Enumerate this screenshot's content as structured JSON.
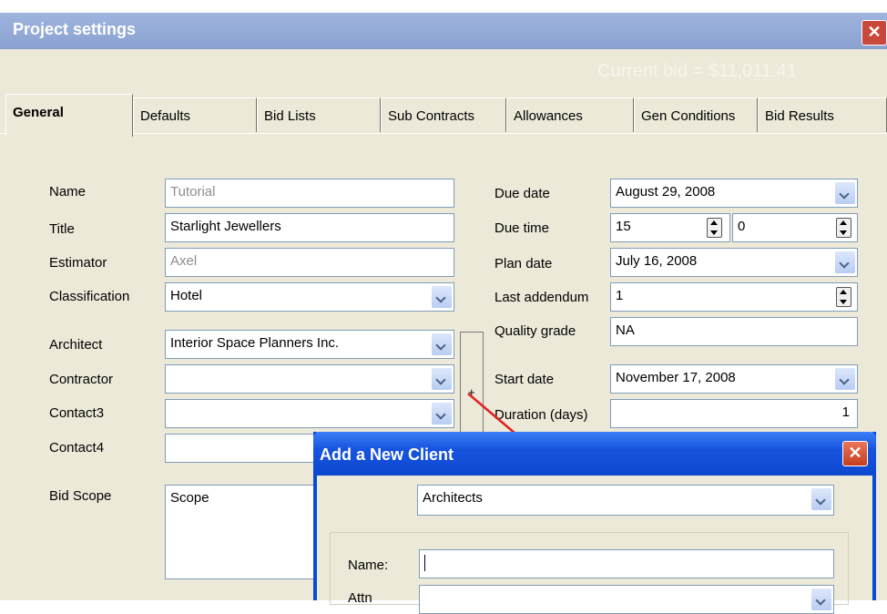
{
  "window": {
    "title": "Project settings",
    "close_label": "✕",
    "current_bid": "Current bid = $11,011.41"
  },
  "tabs": [
    {
      "label": "General",
      "active": true
    },
    {
      "label": "Defaults"
    },
    {
      "label": "Bid Lists"
    },
    {
      "label": "Sub Contracts"
    },
    {
      "label": "Allowances"
    },
    {
      "label": "Gen Conditions"
    },
    {
      "label": "Bid Results"
    }
  ],
  "left": {
    "name_label": "Name",
    "name_value": "Tutorial",
    "title_label": "Title",
    "title_value": "Starlight Jewellers",
    "estimator_label": "Estimator",
    "estimator_value": "Axel",
    "classification_label": "Classification",
    "classification_value": "Hotel",
    "architect_label": "Architect",
    "architect_value": "Interior Space Planners Inc.",
    "contractor_label": "Contractor",
    "contractor_value": "",
    "contact3_label": "Contact3",
    "contact3_value": "",
    "contact4_label": "Contact4",
    "contact4_value": "",
    "bid_scope_label": "Bid Scope",
    "bid_scope_value": "Scope",
    "add_button_label": "+"
  },
  "right": {
    "due_date_label": "Due date",
    "due_date_value": "August 29, 2008",
    "due_time_label": "Due time",
    "due_time_hour": "15",
    "due_time_minute": "0",
    "plan_date_label": "Plan date",
    "plan_date_value": "July 16, 2008",
    "last_addendum_label": "Last addendum",
    "last_addendum_value": "1",
    "quality_grade_label": "Quality grade",
    "quality_grade_value": "NA",
    "start_date_label": "Start date",
    "start_date_value": "November 17, 2008",
    "duration_label": "Duration (days)",
    "duration_value": "1"
  },
  "dialog": {
    "title": "Add a New Client",
    "close_label": "✕",
    "client_type_value": "Architects",
    "name_label": "Name:",
    "name_value": "",
    "attn_label": "Attn"
  },
  "colors": {
    "panel": "#ece9d8",
    "title_bar": "#9fb4de",
    "dialog_title": "#1754de",
    "arrow": "#e02020"
  }
}
